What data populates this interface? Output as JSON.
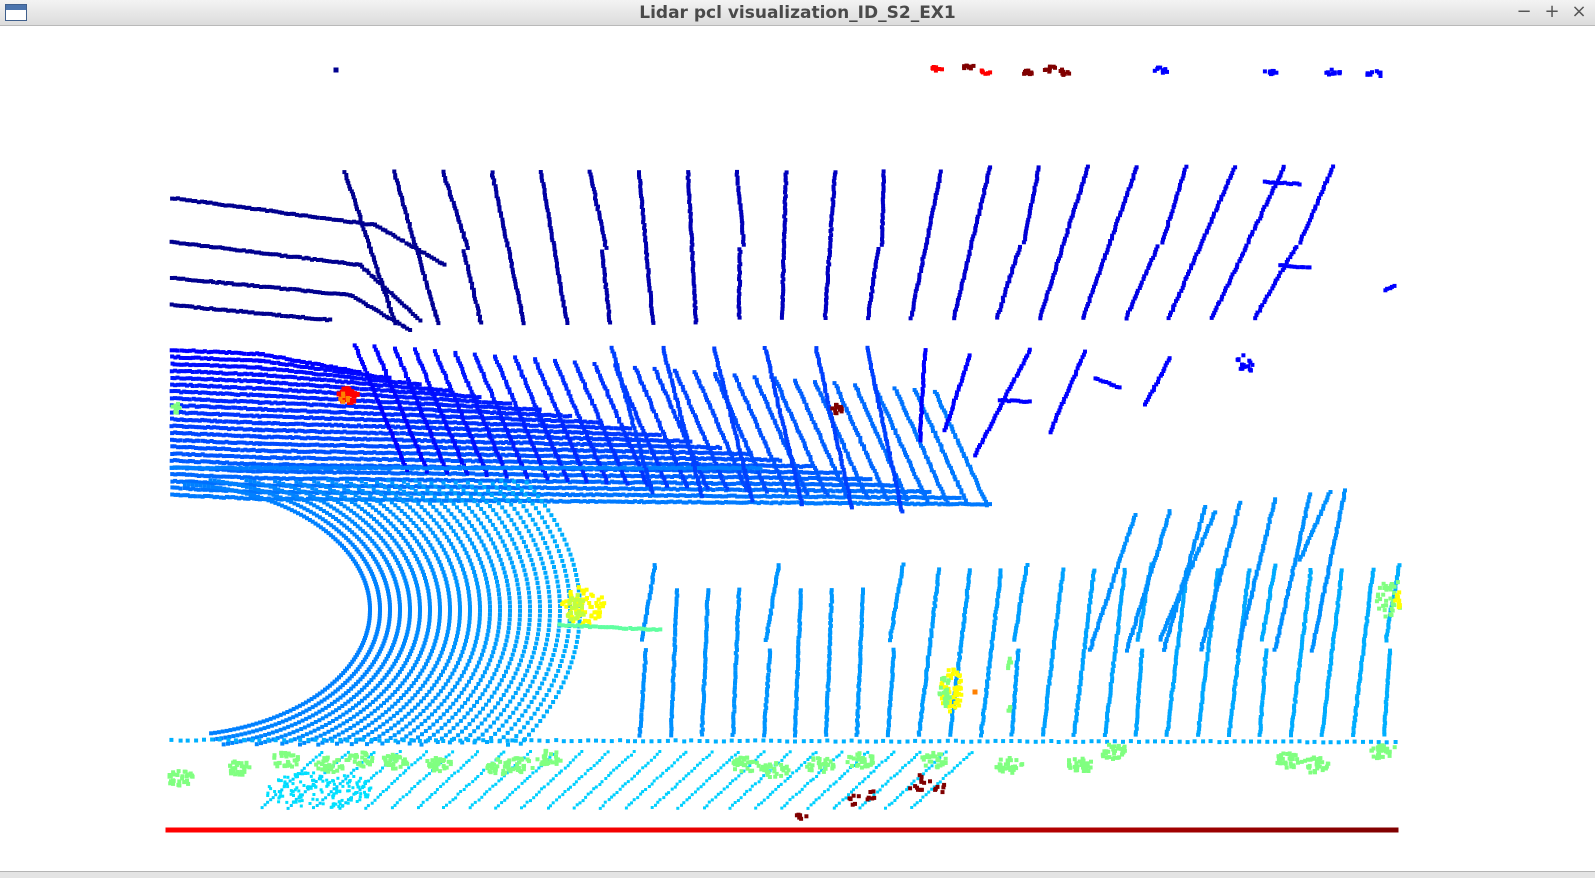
{
  "window": {
    "title": "Lidar pcl visualization_ID_S2_EX1",
    "icon": "app-window-icon",
    "controls": {
      "minimize": "−",
      "maximize": "+",
      "close": "×"
    }
  },
  "viewport": {
    "background": "#ffffff",
    "colormap": [
      "#00008f",
      "#0000ff",
      "#0080ff",
      "#00ffff",
      "#80ff80",
      "#ffff00",
      "#ff8000",
      "#ff0000",
      "#800000"
    ]
  }
}
